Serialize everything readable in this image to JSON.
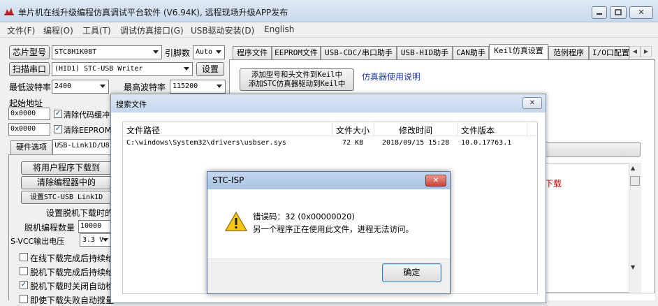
{
  "window": {
    "title": "单片机在线升级编程仿真调试平台软件 (V6.94K), 远程现场升级APP发布",
    "min_label": "▭",
    "max_label": "▭",
    "close_label": "✕"
  },
  "menu": [
    "文件(F)",
    "编程(O)",
    "工具(T)",
    "调试仿真接口(G)",
    "USB驱动安装(D)",
    "English"
  ],
  "left": {
    "chip_model_btn": "芯片型号",
    "chip_model_value": "STC8H1K08T",
    "pins_label": "引脚数",
    "pins_value": "Auto",
    "scan_port_btn": "扫描串口",
    "port_value": "(HID1) STC-USB Writer",
    "settings_btn": "设置",
    "min_baud_label": "最低波特率",
    "min_baud_value": "2400",
    "max_baud_label": "最高波特率",
    "max_baud_value": "115200",
    "start_addr_label": "起始地址",
    "addr1": "0x0000",
    "clear_code_label": "清除代码缓冲",
    "addr2": "0x0000",
    "clear_eeprom_label": "清除EEPROM缓",
    "tab_hw": "硬件选项",
    "tab_link": "USB-Link1D/U8",
    "btn_user_download": "将用户程序下载到",
    "btn_clear_programmer": "清除编程器中的",
    "btn_set_link": "设置STC-USB Link1D",
    "offline_label": "设置脱机下载时的",
    "offline_count_label": "脱机编程数量",
    "offline_count_value": "10000",
    "svcc_label": "S-VCC输出电压",
    "svcc_value": "3.3 V",
    "chk_online_continue": "在线下载完成后持续给",
    "chk_offline_continue": "脱机下载完成后持续给",
    "chk_offline_close": "脱机下载时关闭自动检",
    "chk_fail_auto": "即使下载失败自动搅量"
  },
  "tabs": [
    "程序文件",
    "EEPROM文件",
    "USB-CDC/串口助手",
    "USB-HID助手",
    "CAN助手",
    "Keil仿真设置",
    "范例程序",
    "I/O口配置"
  ],
  "keil": {
    "add_btn_line1": "添加型号和头文件到Keil中",
    "add_btn_line2": "添加STC仿真器驱动到Keil中",
    "manual_link": "仿真器使用说明",
    "side_red_text": "下载"
  },
  "search": {
    "title": "搜索文件",
    "close": "✕",
    "columns": [
      "文件路径",
      "文件大小",
      "修改时间",
      "文件版本"
    ],
    "rows": [
      {
        "path": "C:\\windows\\System32\\drivers\\usbser.sys",
        "size": "72 KB",
        "time": "2018/09/15 15:28",
        "version": "10.0.17763.1"
      }
    ]
  },
  "error": {
    "title": "STC-ISP",
    "close": "✕",
    "line1": "错误码：32 (0x00000020)",
    "line2": "另一个程序正在使用此文件，进程无法访问。",
    "ok": "确定"
  },
  "colors": {
    "accent_blue": "#1f3fa8",
    "red_text": "#c00000",
    "warning_yellow": "#f5c518",
    "close_red": "#c9443a"
  }
}
